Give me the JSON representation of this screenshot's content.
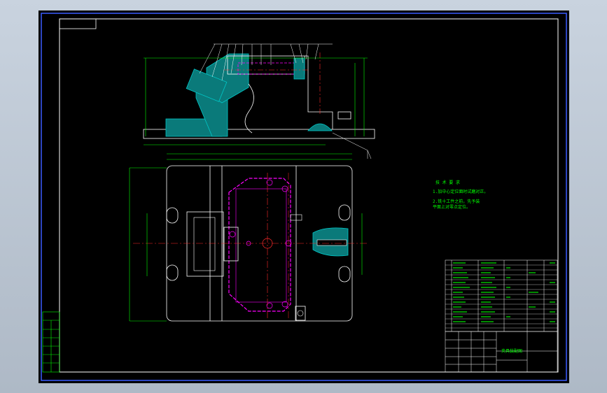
{
  "notes": {
    "title": "技 术 要 求",
    "line1": "1.加中心定位面时试磨对正。",
    "line2": "2.铣十工件之前，先予装",
    "line3": "平面上对零点定位。"
  },
  "title_block": {
    "name": "夹具装配图"
  },
  "colors": {
    "background": "#000000",
    "frame": "#ffffff",
    "part": "#ffffff",
    "dimension": "#00ff00",
    "centerline": "#ff2a2a",
    "hidden": "#ff00ff",
    "section": "#00c8c8",
    "notes": "#00ff00",
    "accent_blue": "#3a5cff"
  }
}
